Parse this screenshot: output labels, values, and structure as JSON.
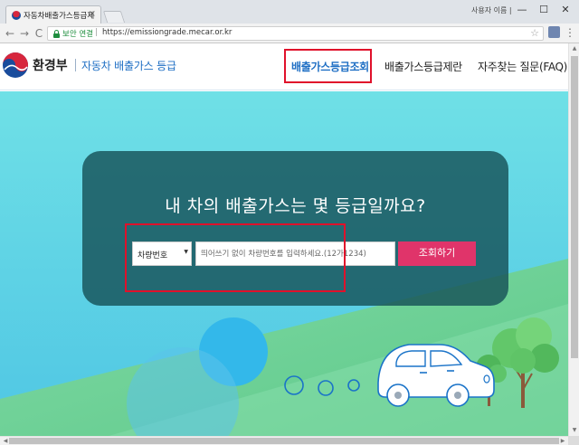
{
  "browser": {
    "tab_title": "자동차배출가스등급제",
    "tab_close": "×",
    "user_label": "사용자 이름 |",
    "window_controls": {
      "minimize": "—",
      "maximize": "☐",
      "close": "✕"
    },
    "nav": {
      "back": "←",
      "forward": "→",
      "reload": "C"
    },
    "secure_label": "보안 연결",
    "url_separator": "|",
    "url": "https://emissiongrade.mecar.or.kr",
    "star": "☆",
    "menu": "⋮"
  },
  "header": {
    "ministry": "환경부",
    "site_title": "자동차 배출가스 등급",
    "nav_items": [
      {
        "label": "배출가스등급조회",
        "active": true
      },
      {
        "label": "배출가스등급제란",
        "active": false
      },
      {
        "label": "자주찾는 질문(FAQ)",
        "active": false
      }
    ]
  },
  "hero": {
    "headline": "내 차의 배출가스는 몇 등급일까요?",
    "search": {
      "select_value": "차량번호",
      "select_arrow": "▼",
      "input_placeholder": "띄어쓰기 없이 차량번호를 입력하세요.(12가1234)",
      "input_value": "",
      "button_label": "조회하기"
    }
  },
  "colors": {
    "brand_blue": "#1f6fc4",
    "button_pink": "#e0346a",
    "highlight_red": "#e0112b",
    "panel_teal": "#165258",
    "sky": "#5fd3e3",
    "grass": "#6fd18f"
  },
  "icons": {
    "logo": "taegeuk-logo-icon",
    "lock": "lock-icon",
    "star": "star-icon",
    "extension": "extension-icon",
    "menu": "kebab-menu-icon",
    "car": "car-illustration",
    "tree": "tree-illustration"
  },
  "scrollbar": {
    "up": "▲",
    "down": "▼",
    "left": "◀",
    "right": "▶"
  }
}
